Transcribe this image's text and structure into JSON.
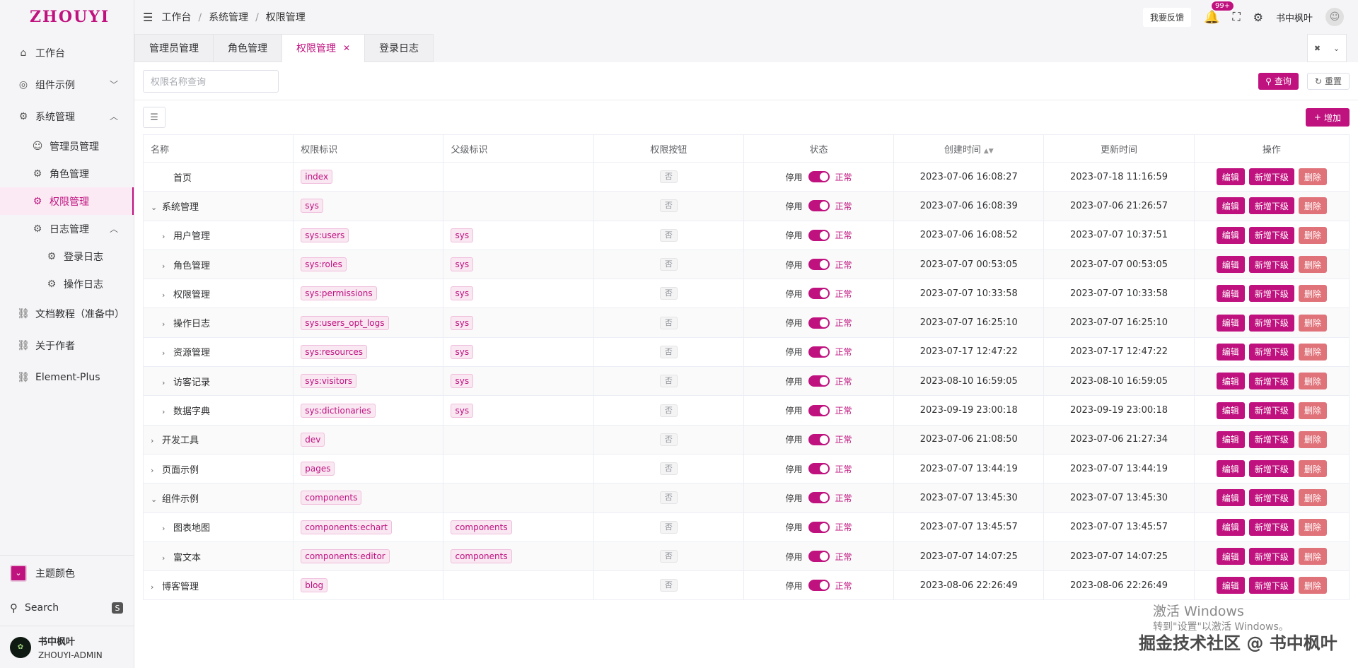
{
  "logo": "ZHOUYI",
  "sidebar": {
    "items": [
      {
        "label": "工作台",
        "icon": "home-icon",
        "level": 1
      },
      {
        "label": "组件示例",
        "icon": "grid-icon",
        "level": 1,
        "arrow": "down"
      },
      {
        "label": "系统管理",
        "icon": "gear-icon",
        "level": 1,
        "arrow": "up"
      },
      {
        "label": "管理员管理",
        "icon": "user-icon",
        "level": 2
      },
      {
        "label": "角色管理",
        "icon": "gear-icon",
        "level": 2
      },
      {
        "label": "权限管理",
        "icon": "gear-icon",
        "level": 2,
        "active": true
      },
      {
        "label": "日志管理",
        "icon": "gear-icon",
        "level": 2,
        "arrow": "up"
      },
      {
        "label": "登录日志",
        "icon": "gear-icon",
        "level": 3
      },
      {
        "label": "操作日志",
        "icon": "gear-icon",
        "level": 3
      },
      {
        "label": "文档教程（准备中）",
        "icon": "link-icon",
        "level": 1
      },
      {
        "label": "关于作者",
        "icon": "link-icon",
        "level": 1
      },
      {
        "label": "Element-Plus",
        "icon": "link-icon",
        "level": 1
      }
    ],
    "theme_label": "主题颜色",
    "search_label": "Search",
    "search_key": "S",
    "user_name": "书中枫叶",
    "user_role": "ZHOUYI-ADMIN"
  },
  "topbar": {
    "breadcrumb": [
      "工作台",
      "系统管理",
      "权限管理"
    ],
    "feedback": "我要反馈",
    "badge": "99+",
    "username": "书中枫叶"
  },
  "tabs": [
    {
      "label": "管理员管理"
    },
    {
      "label": "角色管理"
    },
    {
      "label": "权限管理",
      "active": true
    },
    {
      "label": "登录日志"
    }
  ],
  "query": {
    "placeholder": "权限名称查询",
    "search_btn": "查询",
    "reset_btn": "重置",
    "add_btn": "增加"
  },
  "table": {
    "headers": [
      "名称",
      "权限标识",
      "父级标识",
      "权限按钮",
      "状态",
      "创建时间",
      "更新时间",
      "操作"
    ],
    "switch_off": "停用",
    "switch_on": "正常",
    "button_no": "否",
    "op_edit": "编辑",
    "op_add": "新增下级",
    "op_delete": "删除",
    "rows": [
      {
        "name": "首页",
        "indent": 1,
        "expander": "",
        "code": "index",
        "parent": "",
        "created": "2023-07-06 16:08:27",
        "updated": "2023-07-18 11:16:59"
      },
      {
        "name": "系统管理",
        "indent": 0,
        "expander": "open",
        "code": "sys",
        "parent": "",
        "created": "2023-07-06 16:08:39",
        "updated": "2023-07-06 21:26:57"
      },
      {
        "name": "用户管理",
        "indent": 1,
        "expander": "closed",
        "code": "sys:users",
        "parent": "sys",
        "created": "2023-07-06 16:08:52",
        "updated": "2023-07-07 10:37:51"
      },
      {
        "name": "角色管理",
        "indent": 1,
        "expander": "closed",
        "code": "sys:roles",
        "parent": "sys",
        "created": "2023-07-07 00:53:05",
        "updated": "2023-07-07 00:53:05"
      },
      {
        "name": "权限管理",
        "indent": 1,
        "expander": "closed",
        "code": "sys:permissions",
        "parent": "sys",
        "created": "2023-07-07 10:33:58",
        "updated": "2023-07-07 10:33:58"
      },
      {
        "name": "操作日志",
        "indent": 1,
        "expander": "closed",
        "code": "sys:users_opt_logs",
        "parent": "sys",
        "created": "2023-07-07 16:25:10",
        "updated": "2023-07-07 16:25:10"
      },
      {
        "name": "资源管理",
        "indent": 1,
        "expander": "closed",
        "code": "sys:resources",
        "parent": "sys",
        "created": "2023-07-17 12:47:22",
        "updated": "2023-07-17 12:47:22"
      },
      {
        "name": "访客记录",
        "indent": 1,
        "expander": "closed",
        "code": "sys:visitors",
        "parent": "sys",
        "created": "2023-08-10 16:59:05",
        "updated": "2023-08-10 16:59:05"
      },
      {
        "name": "数据字典",
        "indent": 1,
        "expander": "closed",
        "code": "sys:dictionaries",
        "parent": "sys",
        "created": "2023-09-19 23:00:18",
        "updated": "2023-09-19 23:00:18"
      },
      {
        "name": "开发工具",
        "indent": 0,
        "expander": "closed",
        "code": "dev",
        "parent": "",
        "created": "2023-07-06 21:08:50",
        "updated": "2023-07-06 21:27:34"
      },
      {
        "name": "页面示例",
        "indent": 0,
        "expander": "closed",
        "code": "pages",
        "parent": "",
        "created": "2023-07-07 13:44:19",
        "updated": "2023-07-07 13:44:19"
      },
      {
        "name": "组件示例",
        "indent": 0,
        "expander": "open",
        "code": "components",
        "parent": "",
        "created": "2023-07-07 13:45:30",
        "updated": "2023-07-07 13:45:30"
      },
      {
        "name": "图表地图",
        "indent": 1,
        "expander": "closed",
        "code": "components:echart",
        "parent": "components",
        "created": "2023-07-07 13:45:57",
        "updated": "2023-07-07 13:45:57"
      },
      {
        "name": "富文本",
        "indent": 1,
        "expander": "closed",
        "code": "components:editor",
        "parent": "components",
        "created": "2023-07-07 14:07:25",
        "updated": "2023-07-07 14:07:25"
      },
      {
        "name": "博客管理",
        "indent": 0,
        "expander": "closed",
        "code": "blog",
        "parent": "",
        "created": "2023-08-06 22:26:49",
        "updated": "2023-08-06 22:26:49"
      }
    ]
  },
  "overlay": {
    "win_line1": "激活 Windows",
    "win_line2": "转到\"设置\"以激活 Windows。",
    "site": "掘金技术社区 @ 书中枫叶"
  },
  "colors": {
    "accent": "#c0127f",
    "danger": "#e0737a"
  }
}
